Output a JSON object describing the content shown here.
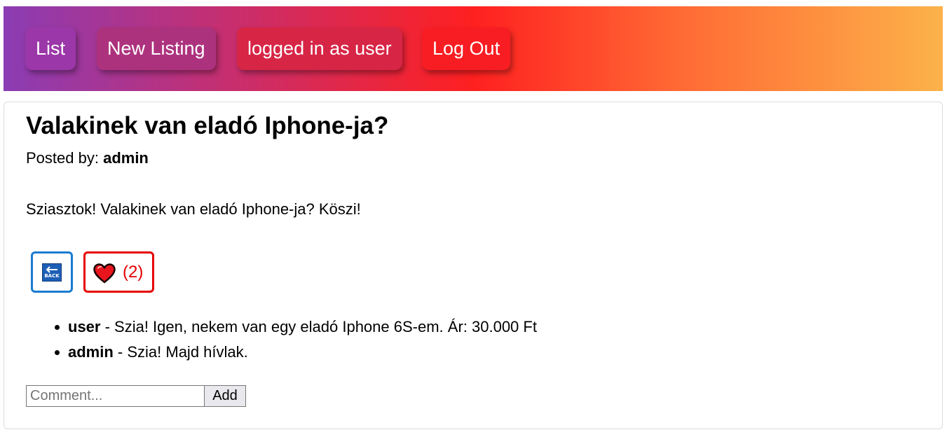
{
  "nav": {
    "items": [
      {
        "label": "List"
      },
      {
        "label": "New Listing"
      },
      {
        "label": "logged in as user"
      },
      {
        "label": "Log Out"
      }
    ]
  },
  "post": {
    "title": "Valakinek van eladó Iphone-ja?",
    "posted_by_label": "Posted by: ",
    "author": "admin",
    "body": "Sziasztok! Valakinek van eladó Iphone-ja? Köszi!"
  },
  "actions": {
    "back_icon": "back-arrow-icon",
    "back_icon_text": "BACK",
    "like_icon": "heart-icon",
    "like_count": "(2)",
    "accent_back": "#1a7bd0",
    "accent_like": "#e50000"
  },
  "comments": [
    {
      "author": "user",
      "text": " - Szia! Igen, nekem van egy eladó Iphone 6S-em. Ár: 30.000 Ft"
    },
    {
      "author": "admin",
      "text": " - Szia! Majd hívlak."
    }
  ],
  "comment_form": {
    "placeholder": "Comment...",
    "value": "",
    "submit_label": "Add"
  },
  "colors": {
    "gradient": [
      "#8b3cb4",
      "#c92e6c",
      "#ff2020",
      "#ff6a34",
      "#fcb24a"
    ]
  }
}
